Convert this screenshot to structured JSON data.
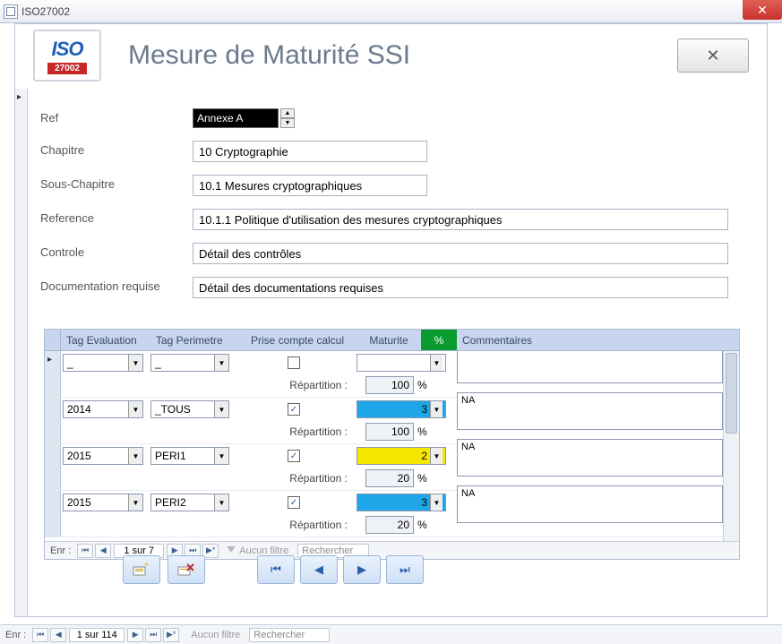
{
  "window": {
    "title": "ISO27002"
  },
  "logo": {
    "text": "ISO",
    "num": "27002"
  },
  "header": {
    "title": "Mesure de Maturité SSI",
    "close": "✕"
  },
  "fields": {
    "ref_label": "Ref",
    "ref_value": "Annexe A",
    "chapitre_label": "Chapitre",
    "chapitre_value": "10 Cryptographie",
    "sous_label": "Sous-Chapitre",
    "sous_value": "10.1 Mesures cryptographiques",
    "reference_label": "Reference",
    "reference_value": "10.1.1 Politique d'utilisation des mesures cryptographiques",
    "controle_label": "Controle",
    "controle_value": "Détail des contrôles",
    "doc_label": "Documentation requise",
    "doc_value": "Détail des documentations requises"
  },
  "subform": {
    "headers": {
      "eval": "Tag Evaluation",
      "peri": "Tag Perimetre",
      "prise": "Prise compte calcul",
      "mat": "Maturite",
      "pct": "%",
      "comm": "Commentaires"
    },
    "rep_label": "Répartition :",
    "rows": [
      {
        "eval": "_",
        "peri": "_",
        "checked": false,
        "mat": "",
        "mat_bg": "",
        "rep": "100",
        "comm": ""
      },
      {
        "eval": "2014",
        "peri": "_TOUS",
        "checked": true,
        "mat": "3",
        "mat_bg": "blue",
        "rep": "100",
        "comm": "NA"
      },
      {
        "eval": "2015",
        "peri": "PERI1",
        "checked": true,
        "mat": "2",
        "mat_bg": "yellow",
        "rep": "20",
        "comm": "NA"
      },
      {
        "eval": "2015",
        "peri": "PERI2",
        "checked": true,
        "mat": "3",
        "mat_bg": "blue",
        "rep": "20",
        "comm": "NA"
      }
    ],
    "recnav": {
      "label": "Enr :",
      "pos": "1 sur 7",
      "filter": "Aucun filtre",
      "search": "Rechercher"
    }
  },
  "navbtns": {
    "new": "new",
    "delete": "delete",
    "first": "⏮",
    "prev": "◀",
    "next": "▶",
    "last": "⏭"
  },
  "outer_recnav": {
    "label": "Enr :",
    "pos": "1 sur 114",
    "filter": "Aucun filtre",
    "search": "Rechercher"
  }
}
